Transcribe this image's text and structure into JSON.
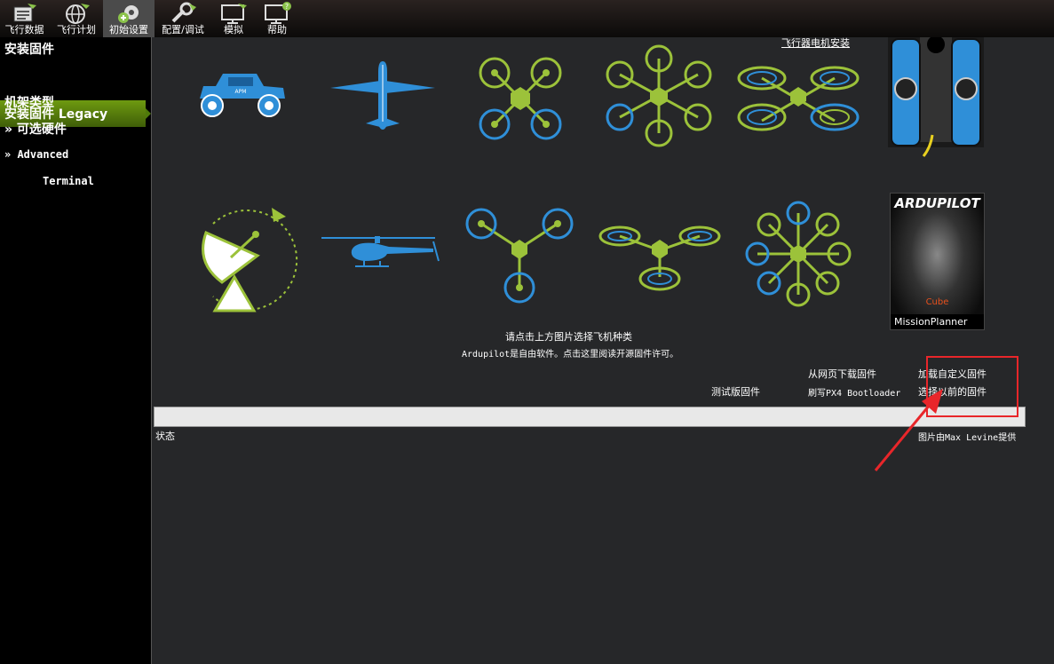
{
  "toolbar": {
    "items": [
      {
        "label": "飞行数据",
        "icon": "flight-data-icon"
      },
      {
        "label": "飞行计划",
        "icon": "globe-icon"
      },
      {
        "label": "初始设置",
        "icon": "gear-icon"
      },
      {
        "label": "配置/调试",
        "icon": "wrench-icon"
      },
      {
        "label": "模拟",
        "icon": "monitor-icon"
      },
      {
        "label": "帮助",
        "icon": "help-monitor-icon"
      }
    ]
  },
  "sidebar": {
    "items": [
      {
        "label": "安装固件"
      },
      {
        "label": "安装固件 Legacy"
      },
      {
        "label": "机架类型"
      },
      {
        "label": "»  可选硬件"
      },
      {
        "label": "» Advanced"
      },
      {
        "label": "Terminal"
      }
    ]
  },
  "main": {
    "motor_link": "飞行器电机安装",
    "cube_brand": "ARDUPILOT",
    "cube_label": "Cube",
    "cube_mp_label": "MissionPlanner",
    "instruction": "请点击上方图片选择飞机种类",
    "license": "Ardupilot是自由软件。点击这里阅读开源固件许可。",
    "links": {
      "download_web": "从网页下载固件",
      "load_custom": "加载自定义固件",
      "beta": "测试版固件",
      "flash_bootloader": "刷写PX4 Bootloader",
      "previous": "选择以前的固件"
    },
    "status_label": "状态",
    "credit": "图片由Max  Levine提供"
  },
  "colors": {
    "accent_green": "#9cc23a",
    "blue": "#2f8fd8",
    "annotation_red": "#e8262a"
  }
}
